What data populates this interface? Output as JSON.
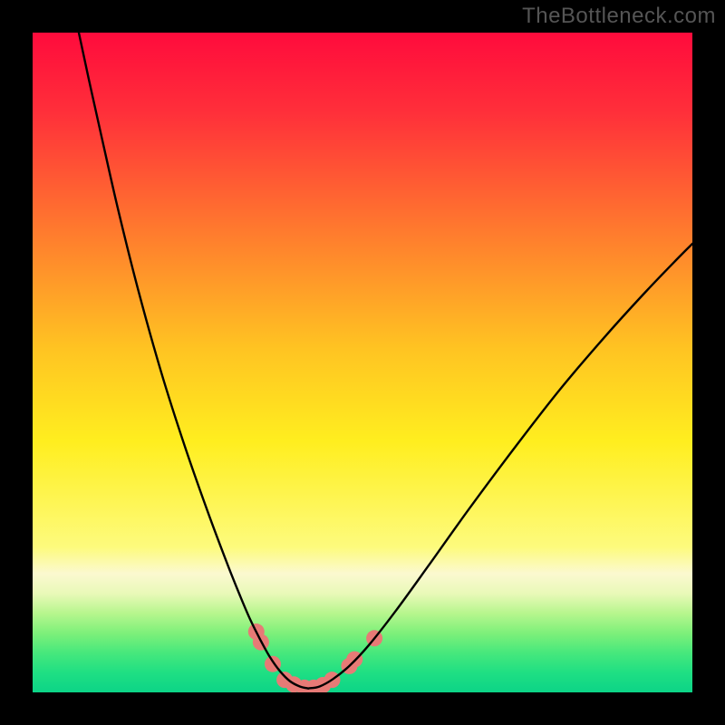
{
  "watermark": "TheBottleneck.com",
  "chart_data": {
    "type": "line",
    "title": "",
    "xlabel": "",
    "ylabel": "",
    "x_range": [
      0,
      100
    ],
    "y_range": [
      0,
      100
    ],
    "gradient_stops": [
      {
        "pct": 0,
        "color": "#ff0b3c"
      },
      {
        "pct": 12,
        "color": "#ff2f3a"
      },
      {
        "pct": 30,
        "color": "#ff7a2e"
      },
      {
        "pct": 48,
        "color": "#ffc422"
      },
      {
        "pct": 62,
        "color": "#ffee1f"
      },
      {
        "pct": 78,
        "color": "#fdfb7d"
      },
      {
        "pct": 82,
        "color": "#fbf9d0"
      },
      {
        "pct": 85,
        "color": "#e9f9b8"
      },
      {
        "pct": 88,
        "color": "#b7f68e"
      },
      {
        "pct": 91,
        "color": "#7ef07a"
      },
      {
        "pct": 94,
        "color": "#47e87c"
      },
      {
        "pct": 97,
        "color": "#1fdf83"
      },
      {
        "pct": 100,
        "color": "#0cd487"
      }
    ],
    "series": [
      {
        "name": "left-curve",
        "stroke": "#000000",
        "width": 2.4,
        "points": [
          {
            "x": 7.0,
            "y": 100.0
          },
          {
            "x": 8.5,
            "y": 93.0
          },
          {
            "x": 10.5,
            "y": 84.0
          },
          {
            "x": 13.0,
            "y": 73.0
          },
          {
            "x": 16.0,
            "y": 61.0
          },
          {
            "x": 19.5,
            "y": 48.5
          },
          {
            "x": 23.0,
            "y": 37.5
          },
          {
            "x": 26.5,
            "y": 27.5
          },
          {
            "x": 29.5,
            "y": 19.5
          },
          {
            "x": 31.5,
            "y": 14.5
          },
          {
            "x": 33.0,
            "y": 11.0
          },
          {
            "x": 34.5,
            "y": 8.0
          },
          {
            "x": 36.0,
            "y": 5.3
          },
          {
            "x": 37.5,
            "y": 3.2
          },
          {
            "x": 39.0,
            "y": 1.7
          },
          {
            "x": 40.5,
            "y": 0.9
          },
          {
            "x": 41.8,
            "y": 0.6
          }
        ]
      },
      {
        "name": "right-curve",
        "stroke": "#000000",
        "width": 2.4,
        "points": [
          {
            "x": 41.8,
            "y": 0.6
          },
          {
            "x": 43.5,
            "y": 0.9
          },
          {
            "x": 45.5,
            "y": 2.0
          },
          {
            "x": 48.0,
            "y": 4.0
          },
          {
            "x": 51.0,
            "y": 7.2
          },
          {
            "x": 55.0,
            "y": 12.3
          },
          {
            "x": 60.0,
            "y": 19.2
          },
          {
            "x": 66.0,
            "y": 27.6
          },
          {
            "x": 73.0,
            "y": 37.0
          },
          {
            "x": 80.0,
            "y": 46.0
          },
          {
            "x": 87.0,
            "y": 54.2
          },
          {
            "x": 93.0,
            "y": 60.8
          },
          {
            "x": 98.0,
            "y": 66.0
          },
          {
            "x": 100.0,
            "y": 68.0
          }
        ]
      }
    ],
    "markers": {
      "color": "#e77a76",
      "radius": 9,
      "points": [
        {
          "x": 33.9,
          "y": 9.2
        },
        {
          "x": 34.6,
          "y": 7.6
        },
        {
          "x": 36.4,
          "y": 4.3
        },
        {
          "x": 38.2,
          "y": 1.9
        },
        {
          "x": 39.6,
          "y": 1.2
        },
        {
          "x": 41.2,
          "y": 0.7
        },
        {
          "x": 42.6,
          "y": 0.7
        },
        {
          "x": 44.0,
          "y": 1.1
        },
        {
          "x": 45.4,
          "y": 1.9
        },
        {
          "x": 48.0,
          "y": 4.0
        },
        {
          "x": 48.8,
          "y": 5.0
        },
        {
          "x": 51.8,
          "y": 8.2
        }
      ]
    }
  }
}
